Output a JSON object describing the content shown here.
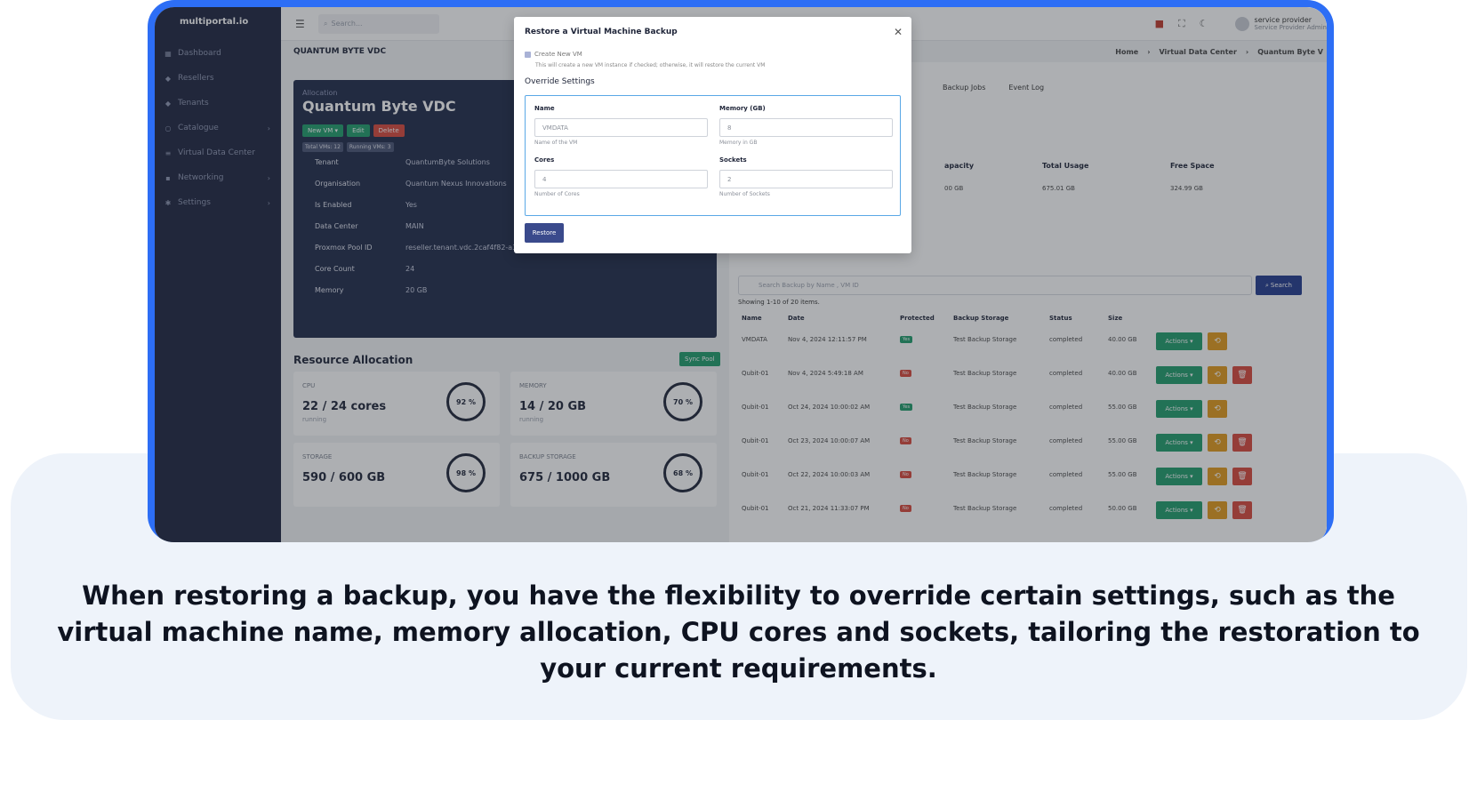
{
  "caption": "When restoring a backup, you have the flexibility to override certain settings, such as the virtual machine name, memory allocation, CPU cores and sockets, tailoring the restoration to your current requirements.",
  "app": {
    "brand": "multiportal.io",
    "search_placeholder": "Search...",
    "user_name": "service provider",
    "user_role": "Service Provider Admin"
  },
  "sidebar": {
    "items": [
      {
        "label": "Dashboard",
        "icon": "grid-icon"
      },
      {
        "label": "Resellers",
        "icon": "users-icon"
      },
      {
        "label": "Tenants",
        "icon": "users-icon"
      },
      {
        "label": "Catalogue",
        "icon": "circle-icon"
      },
      {
        "label": "Virtual Data Center",
        "icon": "server-icon"
      },
      {
        "label": "Networking",
        "icon": "network-icon"
      },
      {
        "label": "Settings",
        "icon": "gear-icon"
      }
    ]
  },
  "page": {
    "title": "QUANTUM BYTE VDC",
    "breadcrumb": [
      "Home",
      "Virtual Data Center",
      "Quantum Byte V"
    ]
  },
  "allocation": {
    "subtitle": "Allocation",
    "title": "Quantum Byte VDC",
    "buttons": {
      "new_vm": "New VM ▾",
      "edit": "Edit",
      "delete": "Delete"
    },
    "tags": [
      "Total VMs: 12",
      "Running VMs: 3"
    ],
    "fields": [
      {
        "k": "Tenant",
        "v": "QuantumByte Solutions"
      },
      {
        "k": "Organisation",
        "v": "Quantum Nexus Innovations"
      },
      {
        "k": "Is Enabled",
        "v": "Yes"
      },
      {
        "k": "Data Center",
        "v": "MAIN"
      },
      {
        "k": "Proxmox Pool ID",
        "v": "reseller.tenant.vdc.2caf4f82-a3bb-4ee1-"
      },
      {
        "k": "Core Count",
        "v": "24"
      },
      {
        "k": "Memory",
        "v": "20 GB"
      }
    ]
  },
  "resources": {
    "title": "Resource Allocation",
    "sync": "Sync Pool",
    "cards": [
      {
        "label": "CPU",
        "value": "22 / 24 cores",
        "sub": "running",
        "pct": "92 %"
      },
      {
        "label": "MEMORY",
        "value": "14 / 20 GB",
        "sub": "running",
        "pct": "70 %"
      },
      {
        "label": "STORAGE",
        "value": "590 / 600 GB",
        "sub": "",
        "pct": "98 %"
      },
      {
        "label": "BACKUP STORAGE",
        "value": "675 / 1000 GB",
        "sub": "",
        "pct": "68 %"
      }
    ]
  },
  "right": {
    "tabs": [
      "Backup Jobs",
      "Event Log"
    ],
    "storage_headers": [
      "apacity",
      "Total Usage",
      "Free Space"
    ],
    "storage_values": [
      "00 GB",
      "675.01 GB",
      "324.99 GB"
    ],
    "search_placeholder": "Search Backup by Name , VM ID",
    "search_button": "Search",
    "showing": "Showing 1-10 of 20 items.",
    "columns": [
      "Name",
      "Date",
      "Protected",
      "Backup Storage",
      "Status",
      "Size"
    ],
    "rows": [
      {
        "name": "VMDATA",
        "date": "Nov 4, 2024 12:11:57 PM",
        "protected": "Yes",
        "storage": "Test Backup Storage",
        "status": "completed",
        "size": "40.00 GB",
        "delete": false
      },
      {
        "name": "Qubit-01",
        "date": "Nov 4, 2024 5:49:18 AM",
        "protected": "No",
        "storage": "Test Backup Storage",
        "status": "completed",
        "size": "40.00 GB",
        "delete": true
      },
      {
        "name": "Qubit-01",
        "date": "Oct 24, 2024 10:00:02 AM",
        "protected": "Yes",
        "storage": "Test Backup Storage",
        "status": "completed",
        "size": "55.00 GB",
        "delete": false
      },
      {
        "name": "Qubit-01",
        "date": "Oct 23, 2024 10:00:07 AM",
        "protected": "No",
        "storage": "Test Backup Storage",
        "status": "completed",
        "size": "55.00 GB",
        "delete": true
      },
      {
        "name": "Qubit-01",
        "date": "Oct 22, 2024 10:00:03 AM",
        "protected": "No",
        "storage": "Test Backup Storage",
        "status": "completed",
        "size": "55.00 GB",
        "delete": true
      },
      {
        "name": "Qubit-01",
        "date": "Oct 21, 2024 11:33:07 PM",
        "protected": "No",
        "storage": "Test Backup Storage",
        "status": "completed",
        "size": "50.00 GB",
        "delete": true
      }
    ],
    "actions_label": "Actions ▾"
  },
  "modal": {
    "title": "Restore a Virtual Machine Backup",
    "checkbox_label": "Create New VM",
    "checkbox_help": "This will create a new VM instance if checked; otherwise, it will restore the current VM",
    "section": "Override Settings",
    "name_label": "Name",
    "name_value": "VMDATA",
    "name_help": "Name of the VM",
    "memory_label": "Memory (GB)",
    "memory_value": "8",
    "memory_help": "Memory in GB",
    "cores_label": "Cores",
    "cores_value": "4",
    "cores_help": "Number of Cores",
    "sockets_label": "Sockets",
    "sockets_value": "2",
    "sockets_help": "Number of Sockets",
    "restore_button": "Restore"
  }
}
